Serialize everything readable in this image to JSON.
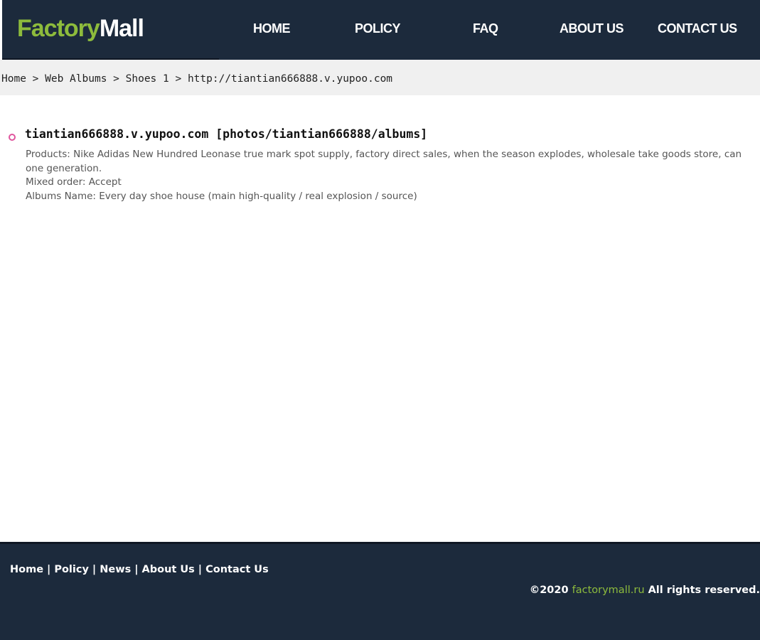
{
  "header": {
    "logo_part1": "Factory",
    "logo_part2": "Mall",
    "nav": [
      "HOME",
      "POLICY",
      "FAQ",
      "ABOUT US",
      "CONTACT US"
    ]
  },
  "breadcrumb": {
    "items": [
      "Home",
      "Web Albums",
      "Shoes 1",
      "http://tiantian666888.v.yupoo.com"
    ],
    "separator": ">"
  },
  "listing": {
    "title": "tiantian666888.v.yupoo.com [photos/tiantian666888/albums]",
    "products": "Products: Nike Adidas New Hundred Leonase true mark spot supply, factory direct sales, when the season explodes, wholesale take goods store, can one generation.",
    "mixed_order": "Mixed order: Accept",
    "albums_name": "Albums Name: Every day shoe house (main high-quality / real explosion / source)"
  },
  "footer": {
    "links": [
      "Home",
      "Policy",
      "News",
      "About Us",
      "Contact Us"
    ],
    "separator": "|",
    "copyright_prefix": "©2020",
    "copyright_site": "factorymall.ru",
    "copyright_suffix": "All rights reserved."
  },
  "colors": {
    "header_bg": "#1c2a3c",
    "brand_green": "#8dbb3c",
    "breadcrumb_bg": "#f0f0f0",
    "bullet_pink": "#e0569e"
  }
}
